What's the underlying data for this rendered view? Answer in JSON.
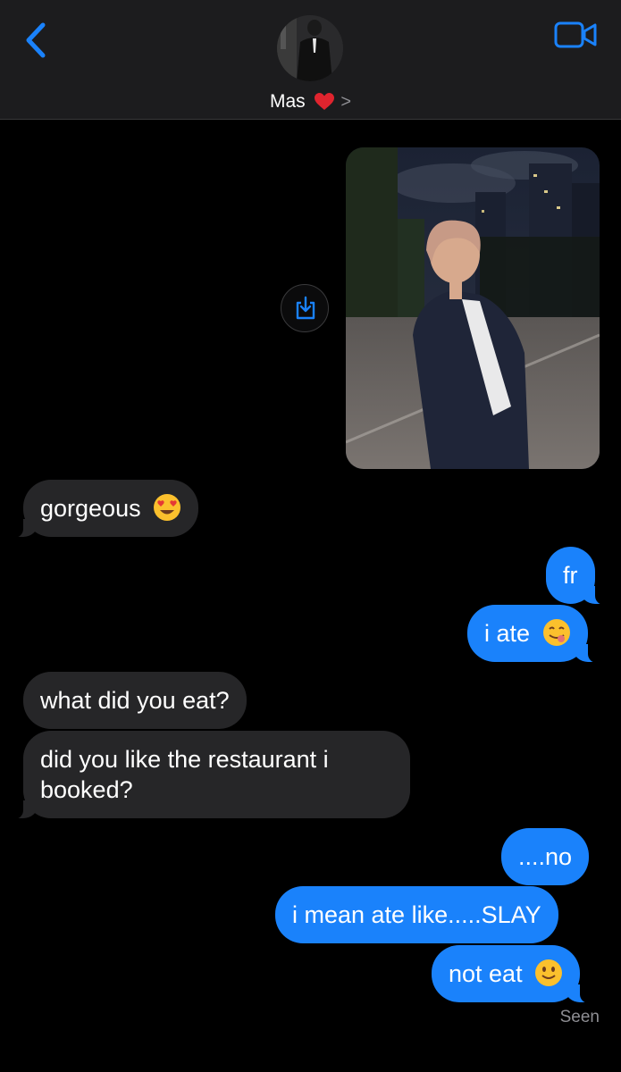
{
  "header": {
    "contact_name": "Mas",
    "chevron": ">",
    "back_icon": "chevron-left-icon",
    "video_icon": "video-camera-icon",
    "accent": "#1a82fb"
  },
  "messages": [
    {
      "from": "them",
      "text": "gorgeous",
      "emoji": "heart-eyes"
    },
    {
      "from": "me",
      "text": "fr"
    },
    {
      "from": "me",
      "text": "i ate",
      "emoji": "yum"
    },
    {
      "from": "them",
      "text": "what did you eat?"
    },
    {
      "from": "them",
      "text": "did you like the restaurant i booked?"
    },
    {
      "from": "me",
      "text": "....no"
    },
    {
      "from": "me",
      "text": "i mean ate like.....SLAY"
    },
    {
      "from": "me",
      "text": "not eat",
      "emoji": "slight-smile"
    }
  ],
  "status": {
    "seen_label": "Seen"
  },
  "colors": {
    "sent_bubble": "#1a82fb",
    "received_bubble": "#262628",
    "header_bg": "#1c1c1e"
  }
}
